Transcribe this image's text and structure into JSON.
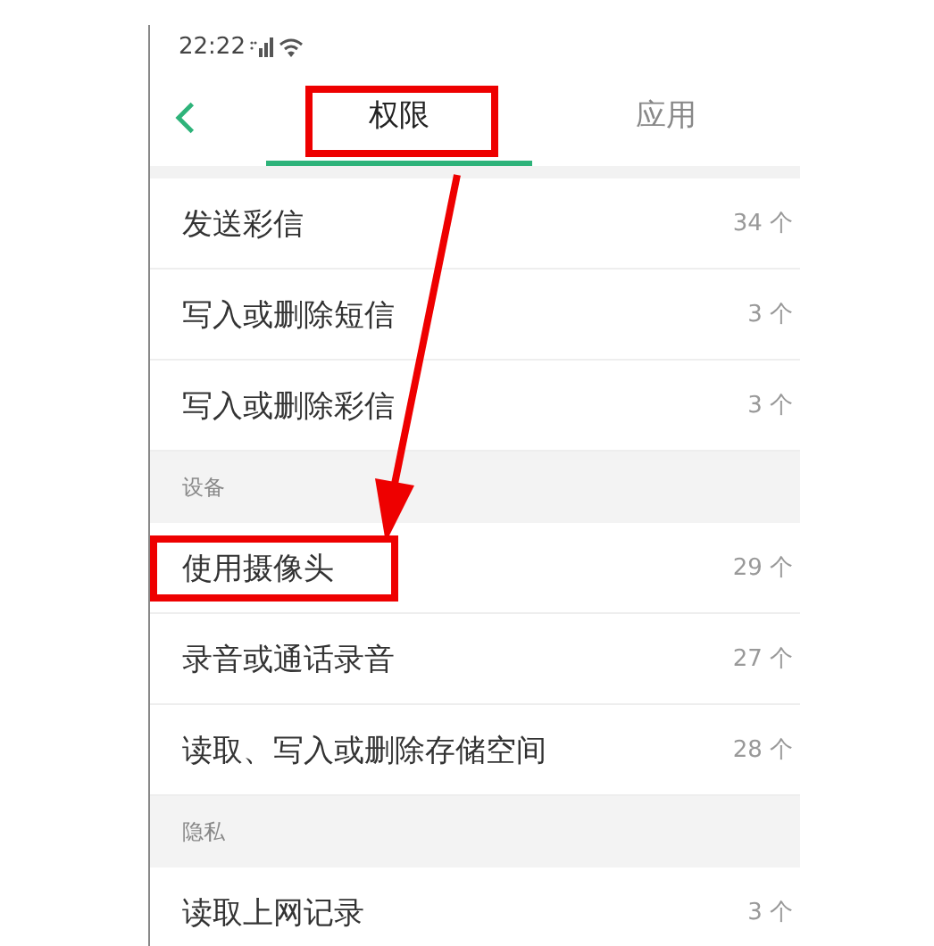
{
  "status_bar": {
    "time": "22:22"
  },
  "tabs": [
    {
      "label": "权限",
      "selected": true,
      "annotated": true
    },
    {
      "label": "应用",
      "selected": false,
      "annotated": false
    }
  ],
  "sections": [
    {
      "items": [
        {
          "name": "发送彩信",
          "count": "34 个",
          "annotated": false
        },
        {
          "name": "写入或删除短信",
          "count": "3 个",
          "annotated": false
        },
        {
          "name": "写入或删除彩信",
          "count": "3 个",
          "annotated": false
        }
      ]
    },
    {
      "header": "设备",
      "items": [
        {
          "name": "使用摄像头",
          "count": "29 个",
          "annotated": true
        },
        {
          "name": "录音或通话录音",
          "count": "27 个",
          "annotated": false
        },
        {
          "name": "读取、写入或删除存储空间",
          "count": "28 个",
          "annotated": false
        }
      ]
    },
    {
      "header": "隐私",
      "items": [
        {
          "name": "读取上网记录",
          "count": "3 个",
          "annotated": false
        }
      ]
    }
  ]
}
